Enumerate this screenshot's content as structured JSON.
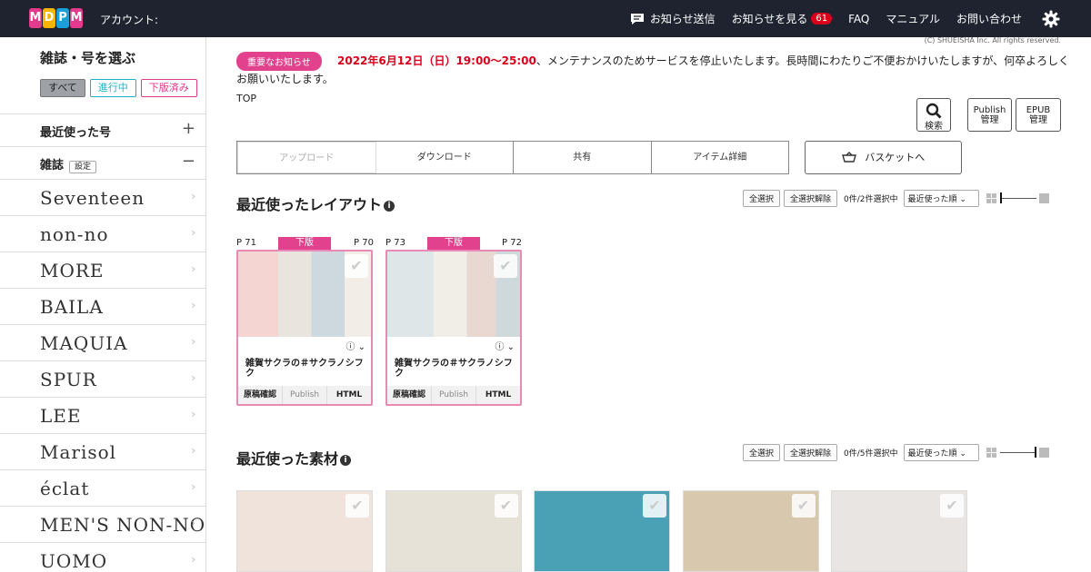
{
  "header": {
    "logo_letters": [
      "M",
      "D",
      "P",
      "M"
    ],
    "logo_colors": [
      "#e23a8c",
      "#f7b500",
      "#1aa0d8",
      "#e23a8c"
    ],
    "account_label": "アカウント:",
    "nav": {
      "send_notice": "お知らせ送信",
      "view_notice": "お知らせを見る",
      "notice_count": "61",
      "faq": "FAQ",
      "manual": "マニュアル",
      "contact": "お問い合わせ"
    },
    "copyright": "(C) SHUEISHA Inc. All rights reserved."
  },
  "sidebar": {
    "title": "雑誌・号を選ぶ",
    "filters": {
      "all": "すべて",
      "in_progress": "進行中",
      "sold": "下版済み"
    },
    "recent_issues": "最近使った号",
    "magazines_label": "雑誌",
    "settings_tag": "設定",
    "magazines": [
      "Seventeen",
      "non-no",
      "MORE",
      "BAILA",
      "MAQUIA",
      "SPUR",
      "LEE",
      "Marisol",
      "éclat",
      "MEN'S NON-NO",
      "UOMO"
    ]
  },
  "notice": {
    "badge": "重要なお知らせ",
    "highlight": "2022年6月12日（日）19:00〜25:00",
    "text": "、メンテナンスのためサービスを停止いたします。長時間にわたりご不便おかけいたしますが、何卒よろしくお願いいたします。"
  },
  "breadcrumb": "TOP",
  "tools": {
    "search": "検索",
    "publish": "Publish\n管理",
    "epub": "EPUB\n管理"
  },
  "tabs": [
    "アップロード",
    "ダウンロード",
    "共有",
    "アイテム詳細"
  ],
  "basket": "バスケットへ",
  "controls": {
    "select_all": "全選択",
    "deselect_all": "全選択解除",
    "sort": "最近使った順"
  },
  "layouts": {
    "title": "最近使ったレイアウト",
    "count": "0件/2件選択中",
    "items": [
      {
        "page_left": "P 71",
        "page_right": "P 70",
        "status": "下版",
        "title": "雑賀サクラの＃サクラノシフク"
      },
      {
        "page_left": "P 73",
        "page_right": "P 72",
        "status": "下版",
        "title": "雑賀サクラの＃サクラノシフク"
      }
    ],
    "foot": {
      "check": "原稿確認",
      "publish": "Publish",
      "html": "HTML"
    }
  },
  "materials": {
    "title": "最近使った素材",
    "count": "0件/5件選択中",
    "tile_colors": [
      "#efe3dc",
      "#e6e2d8",
      "#4aa0b5",
      "#d8c9ae",
      "#e9e5e2"
    ]
  }
}
